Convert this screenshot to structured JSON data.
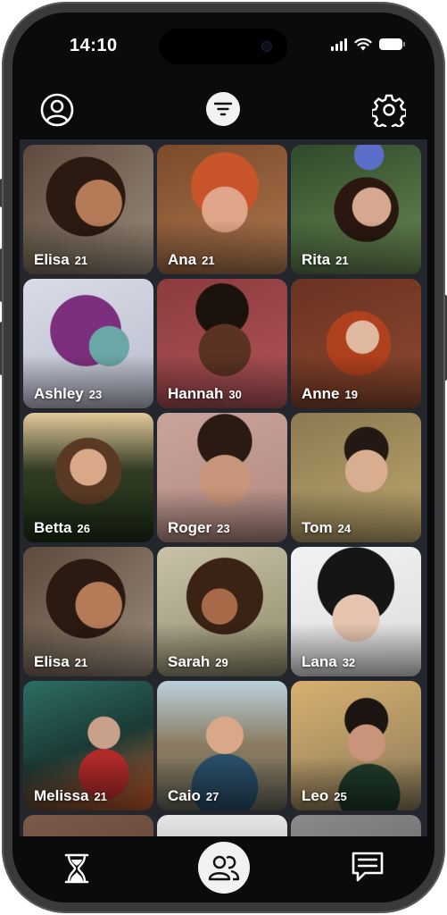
{
  "status_bar": {
    "time": "14:10"
  },
  "header": {
    "profile_icon": "user-circle-icon",
    "filter_icon": "filter-icon",
    "settings_icon": "gear-icon"
  },
  "profiles": [
    {
      "name": "Elisa",
      "age": "21"
    },
    {
      "name": "Ana",
      "age": "21"
    },
    {
      "name": "Rita",
      "age": "21"
    },
    {
      "name": "Ashley",
      "age": "23"
    },
    {
      "name": "Hannah",
      "age": "30"
    },
    {
      "name": "Anne",
      "age": "19"
    },
    {
      "name": "Betta",
      "age": "26"
    },
    {
      "name": "Roger",
      "age": "23"
    },
    {
      "name": "Tom",
      "age": "24"
    },
    {
      "name": "Elisa",
      "age": "21"
    },
    {
      "name": "Sarah",
      "age": "29"
    },
    {
      "name": "Lana",
      "age": "32"
    },
    {
      "name": "Melissa",
      "age": "21"
    },
    {
      "name": "Caio",
      "age": "27"
    },
    {
      "name": "Leo",
      "age": "25"
    }
  ],
  "bottom_nav": {
    "left_icon": "hourglass-icon",
    "center_icon": "people-icon",
    "right_icon": "chat-icon"
  },
  "colors": {
    "background": "#0b0b0d",
    "grid_background": "#23262d",
    "accent_light": "#f2f2f4"
  }
}
